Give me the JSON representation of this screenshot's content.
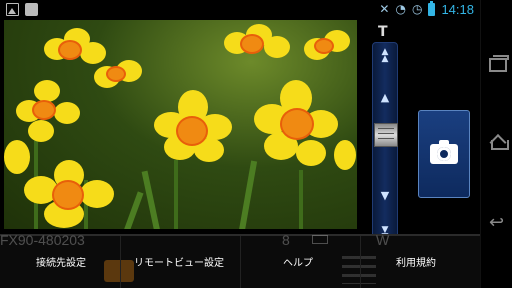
{
  "status_bar": {
    "time": "14:18",
    "left_icons": [
      "image-icon",
      "shopping-bag-icon"
    ],
    "right_icons": [
      "mute-icon",
      "wifi-icon",
      "alarm-icon",
      "battery-icon"
    ]
  },
  "photo": {
    "ghost_model_text": "FX90-480203"
  },
  "zoom": {
    "tele_label": "T"
  },
  "shutter": {
    "icon": "camera-icon"
  },
  "ghost_status": {
    "count": "8",
    "zoom_mode": "W"
  },
  "actions": {
    "connection_settings": "接続先設定",
    "remote_view_settings": "リモートビュー設定",
    "help": "ヘルプ",
    "terms": "利用規約"
  },
  "nav_bar": {
    "buttons": [
      "recent-apps-icon",
      "home-icon",
      "back-icon"
    ]
  }
}
